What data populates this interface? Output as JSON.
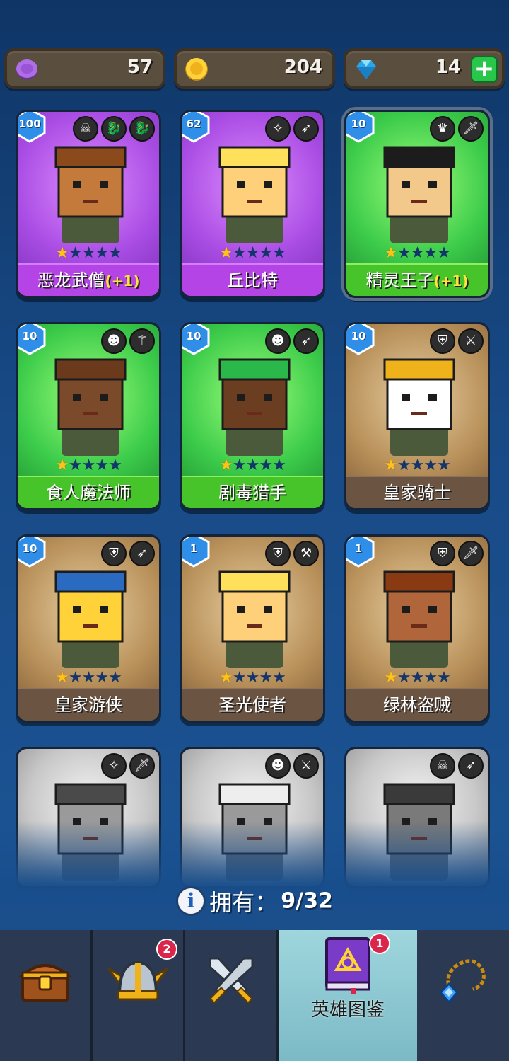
{
  "currency": {
    "tokens": "57",
    "coins": "204",
    "gems": "14",
    "plus_label": "+"
  },
  "heroes": [
    {
      "name": "恶龙武僧",
      "bonus": "(+1)",
      "level": "100",
      "stars": 1,
      "max_stars": 5,
      "rarity": "purple",
      "badges": [
        "skull-icon",
        "dragon-icon",
        "dragon-icon"
      ]
    },
    {
      "name": "丘比特",
      "bonus": "",
      "level": "62",
      "stars": 1,
      "max_stars": 5,
      "rarity": "purple",
      "badges": [
        "angel-icon",
        "bow-icon"
      ]
    },
    {
      "name": "精灵王子",
      "bonus": "(+1)",
      "level": "10",
      "stars": 1,
      "max_stars": 5,
      "rarity": "green",
      "badges": [
        "elf-icon",
        "dagger-icon"
      ]
    },
    {
      "name": "食人魔法师",
      "bonus": "",
      "level": "10",
      "stars": 1,
      "max_stars": 5,
      "rarity": "green",
      "badges": [
        "ogre-icon",
        "staff-icon"
      ]
    },
    {
      "name": "剧毒猎手",
      "bonus": "",
      "level": "10",
      "stars": 1,
      "max_stars": 5,
      "rarity": "green",
      "badges": [
        "ogre-icon",
        "bow-icon"
      ]
    },
    {
      "name": "皇家骑士",
      "bonus": "",
      "level": "10",
      "stars": 1,
      "max_stars": 5,
      "rarity": "brown",
      "badges": [
        "helmet-icon",
        "sword-icon"
      ]
    },
    {
      "name": "皇家游侠",
      "bonus": "",
      "level": "10",
      "stars": 1,
      "max_stars": 5,
      "rarity": "brown",
      "badges": [
        "helmet-icon",
        "bow-icon"
      ]
    },
    {
      "name": "圣光使者",
      "bonus": "",
      "level": "1",
      "stars": 1,
      "max_stars": 5,
      "rarity": "brown",
      "badges": [
        "helmet-icon",
        "hammer-icon"
      ]
    },
    {
      "name": "绿林盗贼",
      "bonus": "",
      "level": "1",
      "stars": 1,
      "max_stars": 5,
      "rarity": "brown",
      "badges": [
        "helmet-icon",
        "dagger-icon"
      ]
    },
    {
      "name": "",
      "bonus": "",
      "level": "",
      "stars": 0,
      "max_stars": 5,
      "rarity": "gray",
      "badges": [
        "angel-icon",
        "dagger-icon"
      ]
    },
    {
      "name": "",
      "bonus": "",
      "level": "",
      "stars": 0,
      "max_stars": 5,
      "rarity": "gray",
      "badges": [
        "ogre-icon",
        "sword-icon"
      ]
    },
    {
      "name": "",
      "bonus": "",
      "level": "",
      "stars": 0,
      "max_stars": 5,
      "rarity": "gray",
      "badges": [
        "skull-icon",
        "bow-icon"
      ]
    }
  ],
  "owned": {
    "label": "拥有：",
    "count": "9/32"
  },
  "nav": {
    "tabs": [
      {
        "icon": "treasure-chest-icon",
        "label": "",
        "badge": ""
      },
      {
        "icon": "viking-helmet-icon",
        "label": "",
        "badge": "2"
      },
      {
        "icon": "crossed-swords-icon",
        "label": "",
        "badge": ""
      },
      {
        "icon": "spellbook-icon",
        "label": "英雄图鉴",
        "badge": "1",
        "active": true
      },
      {
        "icon": "amulet-icon",
        "label": "",
        "badge": ""
      }
    ]
  },
  "colors": {
    "purple": "#a94de4",
    "green": "#3ccb4a",
    "brown": "#b8905a",
    "level_badge": "#2f8fe8",
    "star_on": "#ffc21a",
    "bonus": "#ffe23a"
  }
}
